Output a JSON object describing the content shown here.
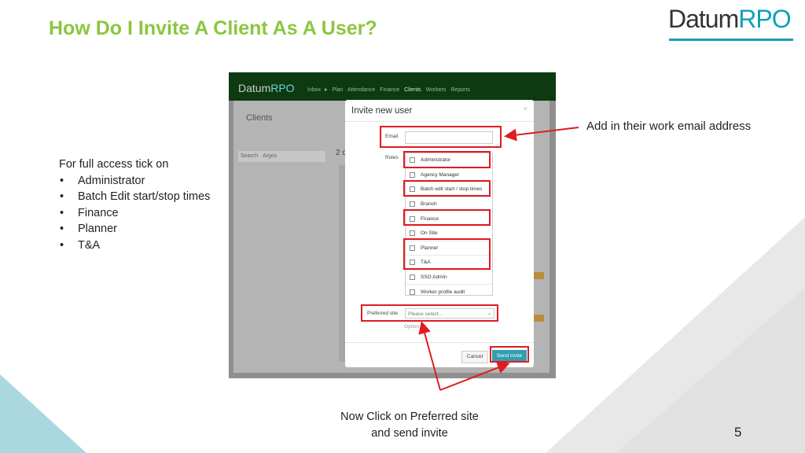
{
  "slide": {
    "title": "How Do I Invite A Client As A User?",
    "page_number": "5"
  },
  "logo": {
    "part1": "Datum",
    "part2": "RPO"
  },
  "instructions": {
    "intro": "For full access tick on",
    "items": [
      "Administrator",
      "Batch Edit start/stop times",
      "Finance",
      "Planner",
      "T&A"
    ]
  },
  "callouts": {
    "email": "Add in their work email address",
    "bottom_line1": "Now Click on Preferred site",
    "bottom_line2": "and send invite"
  },
  "screenshot": {
    "app_logo": {
      "part1": "Datum",
      "part2": "RPO"
    },
    "nav": [
      "Inbox",
      "Plan",
      "Attendance",
      "Finance",
      "Clients",
      "Workers",
      "Reports"
    ],
    "page_title": "Clients",
    "search_label": "Search",
    "search_value": "Argos",
    "count_text": "2 c",
    "modal": {
      "title": "Invite new user",
      "close": "×",
      "email_label": "Email",
      "roles_label": "Roles",
      "roles": [
        "Administrator",
        "Agency Manager",
        "Batch edit start / stop times",
        "Branch",
        "Finance",
        "On Site",
        "Planner",
        "T&A",
        "SSO Admin",
        "Worker profile audit"
      ],
      "preferred_site_label": "Preferred site",
      "preferred_site_placeholder": "Please select...",
      "options_text": "Option",
      "cancel_label": "Cancel",
      "send_label": "Send invite"
    }
  },
  "colors": {
    "title": "#8cc63f",
    "accent": "#0ea1b8",
    "highlight": "#e11b22",
    "send_button": "#2e9fb0"
  }
}
